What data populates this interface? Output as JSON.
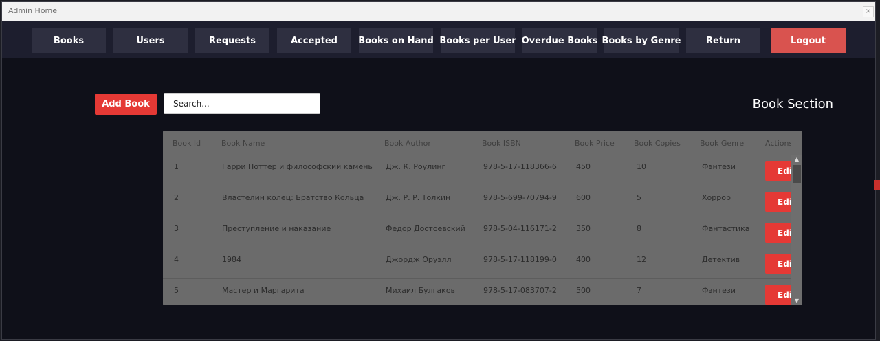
{
  "window": {
    "title": "Admin Home",
    "close_symbol": "×"
  },
  "navbar": {
    "items": [
      {
        "label": "Books"
      },
      {
        "label": "Users"
      },
      {
        "label": "Requests"
      },
      {
        "label": "Accepted"
      },
      {
        "label": "Books on Hand"
      },
      {
        "label": "Books per User"
      },
      {
        "label": "Overdue Books"
      },
      {
        "label": "Books by Genre"
      },
      {
        "label": "Return"
      }
    ],
    "logout_label": "Logout"
  },
  "toolbar": {
    "add_label": "Add Book",
    "search_placeholder": "Search..."
  },
  "section_title": "Book Section",
  "table": {
    "headers": {
      "id": "Book Id",
      "name": "Book Name",
      "author": "Book Author",
      "isbn": "Book ISBN",
      "price": "Book Price",
      "copies": "Book Copies",
      "genre": "Book Genre",
      "actions": "Actions"
    },
    "edit_label": "Edit",
    "rows": [
      {
        "id": "1",
        "name": "Гарри Поттер и философский камень",
        "author": "Дж. К. Роулинг",
        "isbn": "978-5-17-118366-6",
        "price": "450",
        "copies": "10",
        "genre": "Фэнтези"
      },
      {
        "id": "2",
        "name": "Властелин колец: Братство Кольца",
        "author": "Дж. Р. Р. Толкин",
        "isbn": "978-5-699-70794-9",
        "price": "600",
        "copies": "5",
        "genre": "Хоррор"
      },
      {
        "id": "3",
        "name": "Преступление и наказание",
        "author": "Федор Достоевский",
        "isbn": "978-5-04-116171-2",
        "price": "350",
        "copies": "8",
        "genre": "Фантастика"
      },
      {
        "id": "4",
        "name": "1984",
        "author": "Джордж Оруэлл",
        "isbn": "978-5-17-118199-0",
        "price": "400",
        "copies": "12",
        "genre": "Детектив"
      },
      {
        "id": "5",
        "name": "Мастер и Маргарита",
        "author": "Михаил Булгаков",
        "isbn": "978-5-17-083707-2",
        "price": "500",
        "copies": "7",
        "genre": "Фэнтези"
      }
    ]
  },
  "colors": {
    "accent": "#e53935",
    "logout": "#d9534f",
    "nav_button": "#2e2f40",
    "navbar": "#1d1e2e",
    "background": "#0f1019",
    "table": "#6b6b6b"
  }
}
